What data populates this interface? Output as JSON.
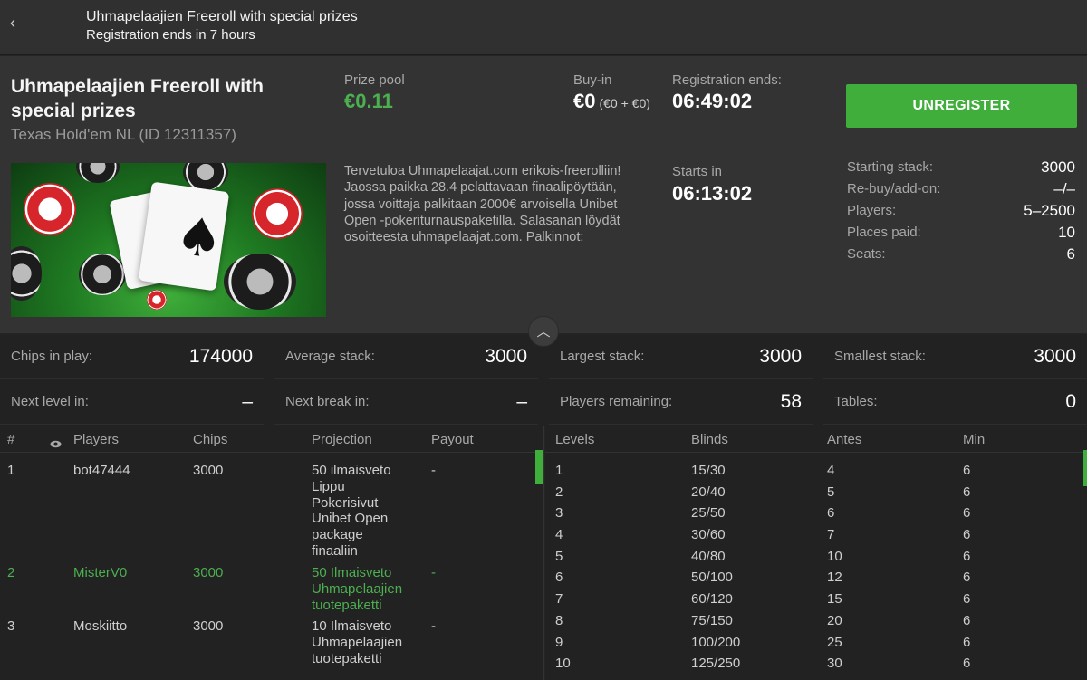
{
  "topbar": {
    "back_icon": "chevron-left-icon",
    "title": "Uhmapelaajien Freeroll with special prizes",
    "subtitle": "Registration ends in 7 hours"
  },
  "tournament": {
    "name": "Uhmapelaajien Freeroll with special prizes",
    "game": "Texas Hold'em NL (ID 12311357)",
    "prize_pool_label": "Prize pool",
    "prize_pool": "€0.11",
    "buyin_label": "Buy-in",
    "buyin": "€0",
    "buyin_detail": "(€0 + €0)",
    "reg_ends_label": "Registration ends:",
    "reg_ends": "06:49:02",
    "starts_label": "Starts in",
    "starts": "06:13:02",
    "description": "Tervetuloa Uhmapelaajat.com erikois-freerolliin! Jaossa paikka 28.4 pelattavaan finaalipöytään, jossa voittaja palkitaan 2000€ arvoisella Unibet Open -pokeriturnauspaketilla. Salasanan löydät osoitteesta uhmapelaajat.com. Palkinnot:",
    "unregister_label": "UNREGISTER",
    "accent_color": "#3fae3a"
  },
  "info": [
    {
      "label": "Starting stack:",
      "value": "3000"
    },
    {
      "label": "Re-buy/add-on:",
      "value": "–/–"
    },
    {
      "label": "Players:",
      "value": "5–2500"
    },
    {
      "label": "Places paid:",
      "value": "10"
    },
    {
      "label": "Seats:",
      "value": "6"
    }
  ],
  "stats": {
    "chips_in_play_label": "Chips in play:",
    "chips_in_play": "174000",
    "average_stack_label": "Average stack:",
    "average_stack": "3000",
    "largest_stack_label": "Largest stack:",
    "largest_stack": "3000",
    "smallest_stack_label": "Smallest stack:",
    "smallest_stack": "3000",
    "next_level_label": "Next level in:",
    "next_level": "–",
    "next_break_label": "Next break in:",
    "next_break": "–",
    "players_remaining_label": "Players remaining:",
    "players_remaining": "58",
    "tables_label": "Tables:",
    "tables": "0"
  },
  "players_table": {
    "headers": {
      "rank": "#",
      "players": "Players",
      "chips": "Chips",
      "projection": "Projection",
      "payout": "Payout"
    },
    "rows": [
      {
        "rank": "1",
        "player": "bot47444",
        "chips": "3000",
        "projection": "50 ilmaisveto Lippu Pokerisivut Unibet Open package finaaliin",
        "payout": "-"
      },
      {
        "rank": "2",
        "player": "MisterV0",
        "chips": "3000",
        "projection": "50 Ilmaisveto Uhmapelaajien tuotepaketti",
        "payout": "-"
      },
      {
        "rank": "3",
        "player": "Moskiitto",
        "chips": "3000",
        "projection": "10 Ilmaisveto Uhmapelaajien tuotepaketti",
        "payout": "-"
      }
    ]
  },
  "levels_table": {
    "headers": {
      "levels": "Levels",
      "blinds": "Blinds",
      "antes": "Antes",
      "min": "Min"
    },
    "rows": [
      {
        "level": "1",
        "blinds": "15/30",
        "antes": "4",
        "min": "6"
      },
      {
        "level": "2",
        "blinds": "20/40",
        "antes": "5",
        "min": "6"
      },
      {
        "level": "3",
        "blinds": "25/50",
        "antes": "6",
        "min": "6"
      },
      {
        "level": "4",
        "blinds": "30/60",
        "antes": "7",
        "min": "6"
      },
      {
        "level": "5",
        "blinds": "40/80",
        "antes": "10",
        "min": "6"
      },
      {
        "level": "6",
        "blinds": "50/100",
        "antes": "12",
        "min": "6"
      },
      {
        "level": "7",
        "blinds": "60/120",
        "antes": "15",
        "min": "6"
      },
      {
        "level": "8",
        "blinds": "75/150",
        "antes": "20",
        "min": "6"
      },
      {
        "level": "9",
        "blinds": "100/200",
        "antes": "25",
        "min": "6"
      },
      {
        "level": "10",
        "blinds": "125/250",
        "antes": "30",
        "min": "6"
      }
    ]
  }
}
